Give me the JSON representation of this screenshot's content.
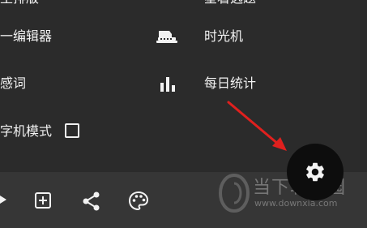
{
  "menu": {
    "top_left_partial": "主排版",
    "top_right_partial": "星着选题",
    "editor_label": "一编辑器",
    "time_machine_label": "时光机",
    "sensitive_label": "感词",
    "daily_stats_label": "每日统计",
    "typewriter_label": "字机模式",
    "typewriter_checked": false
  },
  "icons": {
    "time_machine": "typewriter-icon",
    "daily_stats": "bar-chart-icon",
    "checkbox": "checkbox-icon",
    "bottom_1": "partial-arrow-icon",
    "bottom_2": "add-box-icon",
    "bottom_3": "share-icon",
    "bottom_4": "palette-icon",
    "fab": "settings-gear-icon",
    "annotation": "red-arrow"
  },
  "colors": {
    "background": "#2b2b2b",
    "bottom_bar": "#363636",
    "fab": "#0d0d0d",
    "icon": "#f2f2f2",
    "annotation": "#e0201e"
  },
  "watermark": {
    "title": "当下软件园",
    "url": "www.downxia.com"
  }
}
